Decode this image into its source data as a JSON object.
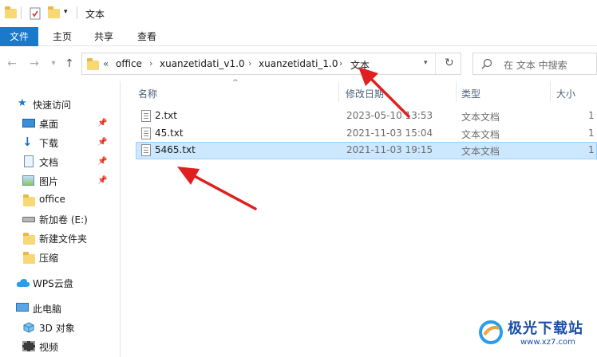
{
  "window": {
    "title": "文本"
  },
  "ribbon": {
    "tabs": [
      "文件",
      "主页",
      "共享",
      "查看"
    ]
  },
  "address": {
    "overflow": "«",
    "crumbs": [
      "office",
      "xuanzetidati_v1.0",
      "xuanzetidati_1.0",
      "文本"
    ]
  },
  "search": {
    "placeholder": "在 文本 中搜索"
  },
  "sidebar": {
    "quick_access": "快速访问",
    "items": [
      {
        "label": "桌面",
        "pinned": true,
        "icon": "desktop-icon"
      },
      {
        "label": "下载",
        "pinned": true,
        "icon": "download-icon"
      },
      {
        "label": "文档",
        "pinned": true,
        "icon": "document-icon"
      },
      {
        "label": "图片",
        "pinned": true,
        "icon": "picture-icon"
      },
      {
        "label": "office",
        "pinned": false,
        "icon": "folder-icon"
      },
      {
        "label": "新加卷 (E:)",
        "pinned": false,
        "icon": "drive-icon"
      },
      {
        "label": "新建文件夹",
        "pinned": false,
        "icon": "folder-icon"
      },
      {
        "label": "压缩",
        "pinned": false,
        "icon": "folder-icon"
      }
    ],
    "wps": "WPS云盘",
    "this_pc": "此电脑",
    "pc_items": [
      {
        "label": "3D 对象",
        "icon": "3d-objects-icon"
      },
      {
        "label": "视频",
        "icon": "video-icon"
      }
    ]
  },
  "columns": {
    "name": "名称",
    "date": "修改日期",
    "type": "类型",
    "size": "大小"
  },
  "files": [
    {
      "name": "2.txt",
      "date": "2023-05-10 13:53",
      "type": "文本文档",
      "size": "1"
    },
    {
      "name": "45.txt",
      "date": "2021-11-03 15:04",
      "type": "文本文档",
      "size": "1"
    },
    {
      "name": "5465.txt",
      "date": "2021-11-03 19:15",
      "type": "文本文档",
      "size": "1",
      "selected": true
    }
  ],
  "watermark": {
    "title": "极光下载站",
    "url": "www.xz7.com"
  },
  "colors": {
    "accent": "#1979ca",
    "selection": "#cce8ff",
    "annotation_arrow": "#e02020"
  }
}
